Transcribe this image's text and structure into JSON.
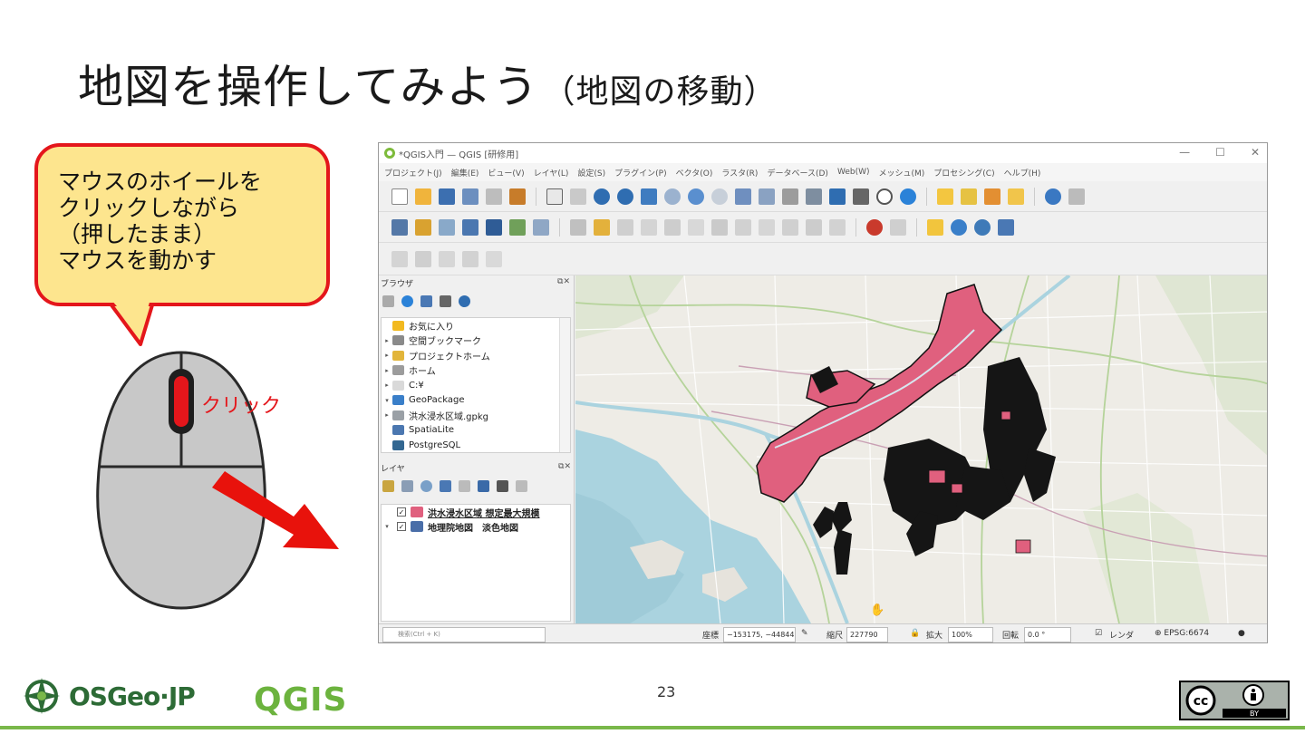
{
  "slide": {
    "title": "地図を操作してみよう",
    "title_sub": "（地図の移動）",
    "page_number": "23"
  },
  "callout": {
    "lines": [
      "マウスのホイールを",
      "クリックしながら",
      "（押したまま）",
      "マウスを動かす"
    ]
  },
  "mouse_label": "クリック",
  "qgis": {
    "window_title": "*QGIS入門 — QGIS [研修用]",
    "menu": [
      "プロジェクト(J)",
      "編集(E)",
      "ビュー(V)",
      "レイヤ(L)",
      "設定(S)",
      "プラグイン(P)",
      "ベクタ(O)",
      "ラスタ(R)",
      "データベース(D)",
      "Web(W)",
      "メッシュ(M)",
      "プロセシング(C)",
      "ヘルプ(H)"
    ],
    "browser_panel": {
      "title": "ブラウザ",
      "items": [
        {
          "label": "お気に入り",
          "icon": "star-icon",
          "color": "#f2b91f",
          "arrow": ""
        },
        {
          "label": "空間ブックマーク",
          "icon": "bookmark-icon",
          "color": "#8a8a8a",
          "arrow": "▸"
        },
        {
          "label": "プロジェクトホーム",
          "icon": "folder-icon",
          "color": "#e2b53a",
          "arrow": "▸"
        },
        {
          "label": "ホーム",
          "icon": "home-icon",
          "color": "#9c9c9c",
          "arrow": "▸"
        },
        {
          "label": "C:¥",
          "icon": "folder-icon",
          "color": "#d9d9d9",
          "arrow": "▸"
        },
        {
          "label": "GeoPackage",
          "icon": "geopackage-icon",
          "color": "#3a7fc9",
          "arrow": "▾"
        },
        {
          "label": "洪水浸水区域.gpkg",
          "icon": "database-icon",
          "color": "#9aa0a6",
          "arrow": "▸"
        },
        {
          "label": "SpatiaLite",
          "icon": "feather-icon",
          "color": "#4b77b0",
          "arrow": ""
        },
        {
          "label": "PostgreSQL",
          "icon": "elephant-icon",
          "color": "#336791",
          "arrow": ""
        }
      ]
    },
    "layers_panel": {
      "title": "レイヤ",
      "items": [
        {
          "label": "洪水浸水区域 想定最大規模",
          "color": "#e0607e",
          "checked": "✓",
          "arrow": ""
        },
        {
          "label": "地理院地図　淡色地図",
          "color": "#4a6ea8",
          "checked": "✓",
          "arrow": "▾"
        }
      ]
    },
    "statusbar": {
      "search_placeholder": "検索(Ctrl + K)",
      "coord_label": "座標",
      "coord_value": "−153175, −44844",
      "scale_label": "縮尺",
      "scale_value": "227790",
      "magnify_label": "拡大",
      "magnify_value": "100%",
      "rotation_label": "回転",
      "rotation_value": "0.0 °",
      "render_label": "レンダ",
      "crs": "EPSG:6674"
    },
    "colors": {
      "flood_fill": "#e0607e",
      "water": "#aad3df",
      "land": "#eeece6"
    }
  }
}
